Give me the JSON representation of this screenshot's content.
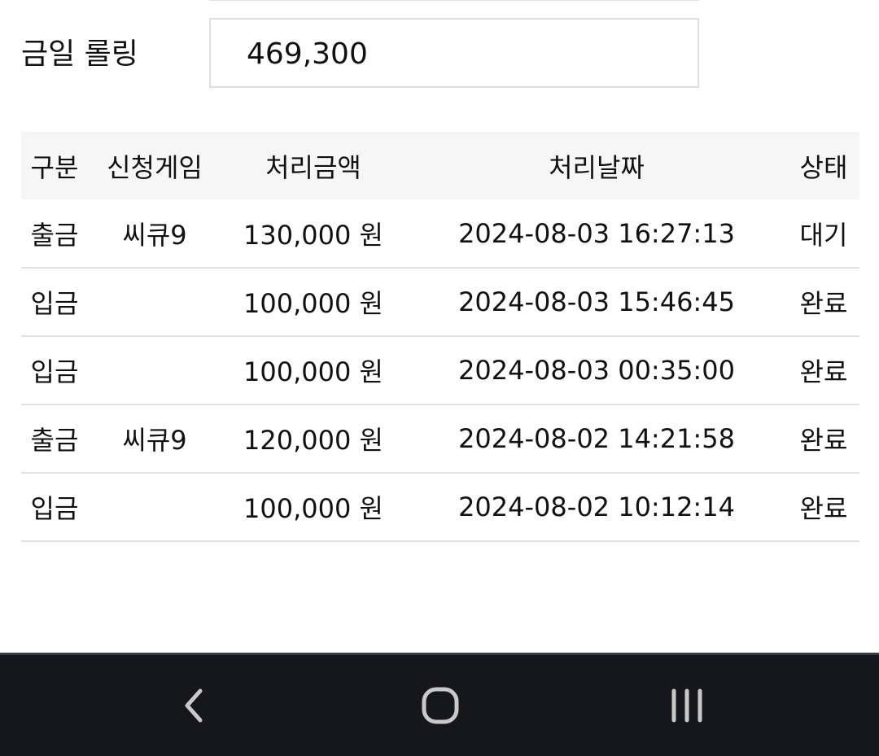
{
  "rolling": {
    "label": "금일 롤링",
    "value": "469,300"
  },
  "table": {
    "headers": [
      "구분",
      "신청게임",
      "처리금액",
      "처리날짜",
      "상태"
    ],
    "rows": [
      {
        "type": "출금",
        "game": "씨큐9",
        "amount": "130,000 원",
        "date": "2024-08-03 16:27:13",
        "status": "대기"
      },
      {
        "type": "입금",
        "game": "",
        "amount": "100,000 원",
        "date": "2024-08-03 15:46:45",
        "status": "완료"
      },
      {
        "type": "입금",
        "game": "",
        "amount": "100,000 원",
        "date": "2024-08-03 00:35:00",
        "status": "완료"
      },
      {
        "type": "출금",
        "game": "씨큐9",
        "amount": "120,000 원",
        "date": "2024-08-02 14:21:58",
        "status": "완료"
      },
      {
        "type": "입금",
        "game": "",
        "amount": "100,000 원",
        "date": "2024-08-02 10:12:14",
        "status": "완료"
      }
    ]
  },
  "colors": {
    "withdraw": "#d10e0e",
    "deposit": "#1717b8",
    "nav_background": "#16161d",
    "nav_icon": "#c9c9c9"
  },
  "nav": {
    "icons": [
      "back-icon",
      "home-icon",
      "recent-apps-icon"
    ]
  }
}
